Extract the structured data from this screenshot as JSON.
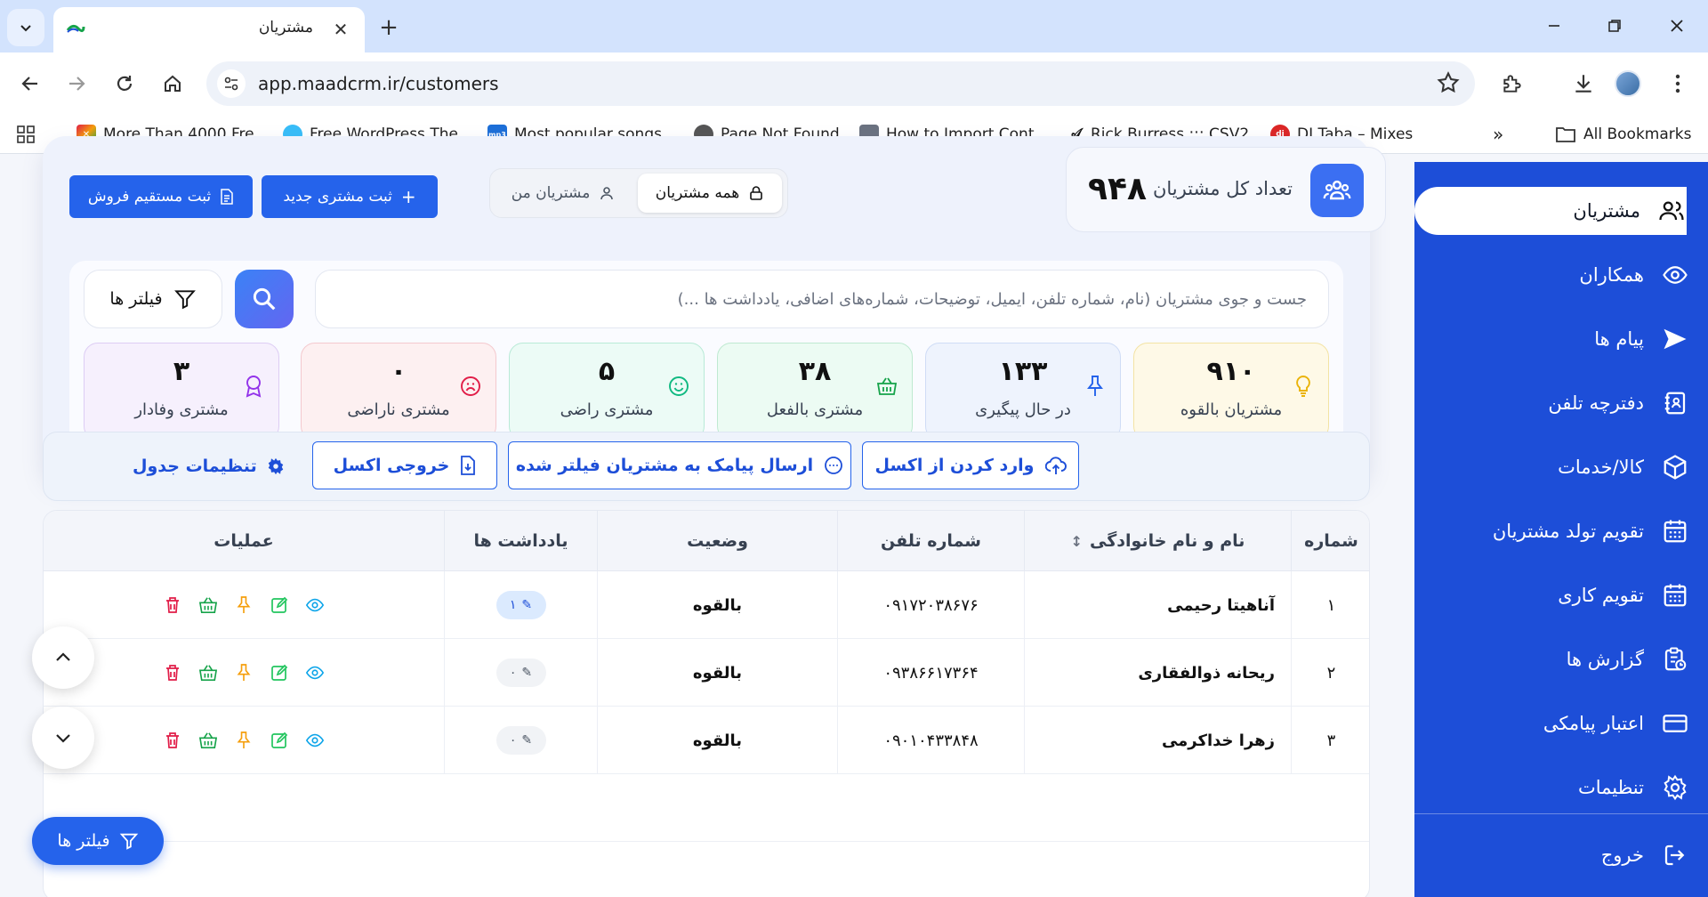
{
  "browser": {
    "tab_title": "مشتریان",
    "url": "app.maadcrm.ir/customers",
    "bookmarks": [
      {
        "label": "More Than 4000 Fre...",
        "icon": "colorful-x-icon"
      },
      {
        "label": "Free WordPress The...",
        "icon": "globe-blue-icon"
      },
      {
        "label": "Most popular songs...",
        "icon": "mp3-icon"
      },
      {
        "label": "Page Not Found",
        "icon": "globe-icon"
      },
      {
        "label": "How to Import Cont...",
        "icon": "lock-folder-icon"
      },
      {
        "label": "Rick Burress ::: CSV2...",
        "icon": "signature-icon"
      },
      {
        "label": "DJ Taba – Mixes",
        "icon": "dj-icon"
      }
    ],
    "all_bookmarks": "All Bookmarks"
  },
  "sidebar": {
    "items": [
      {
        "label": "مشتریان",
        "icon": "users-icon"
      },
      {
        "label": "همکاران",
        "icon": "eye-icon"
      },
      {
        "label": "پیام ها",
        "icon": "send-icon"
      },
      {
        "label": "دفترچه تلفن",
        "icon": "phonebook-icon"
      },
      {
        "label": "کالا/خدمات",
        "icon": "box-icon"
      },
      {
        "label": "تقویم تولد مشتریان",
        "icon": "calendar-icon"
      },
      {
        "label": "تقویم کاری",
        "icon": "calendar-icon"
      },
      {
        "label": "گزارش ها",
        "icon": "report-icon"
      },
      {
        "label": "اعتبار پیامکی",
        "icon": "credit-card-icon"
      },
      {
        "label": "تنظیمات",
        "icon": "gear-icon"
      }
    ],
    "logout": "خروج"
  },
  "header": {
    "count_label": "تعداد کل مشتریان",
    "count_value": "۹۴۸",
    "seg_all": "همه مشتریان",
    "seg_mine": "مشتریان من",
    "new_customer": "ثبت مشتری جدید",
    "direct_sale": "ثبت مستقیم فروش"
  },
  "search": {
    "placeholder": "جست و جوی مشتریان (نام، شماره تلفن، ایمیل، توضیحات، شماره‌های اضافی، یادداشت ها ...)",
    "filters": "فیلتر ها"
  },
  "stats": [
    {
      "value": "۹۱۰",
      "label": "مشتریان بالقوه",
      "bg": "#fef9e7",
      "border": "#f3e3a4",
      "icon_color": "#eab308"
    },
    {
      "value": "۱۳۳",
      "label": "در حال پیگیری",
      "bg": "#eef3fd",
      "border": "#cfdcf6",
      "icon_color": "#2563eb"
    },
    {
      "value": "۳۸",
      "label": "مشتری بالفعل",
      "bg": "#ecfbf3",
      "border": "#bfe9d1",
      "icon_color": "#16a34a"
    },
    {
      "value": "۵",
      "label": "مشتری راضی",
      "bg": "#ecfbf6",
      "border": "#b9ead7",
      "icon_color": "#10b981"
    },
    {
      "value": "۰",
      "label": "مشتری ناراضی",
      "bg": "#fdf0f1",
      "border": "#f4c9ce",
      "icon_color": "#e11d48"
    },
    {
      "value": "۳",
      "label": "مشتری وفادار",
      "bg": "#f6f0fd",
      "border": "#ddcdf4",
      "icon_color": "#9333ea"
    }
  ],
  "actions": {
    "import_excel": "وارد کردن از اکسل",
    "send_sms": "ارسال پیامک به مشتریان فیلتر شده",
    "export_excel": "خروجی اکسل",
    "table_settings": "تنظیمات جدول"
  },
  "table": {
    "headers": {
      "number": "شماره",
      "name": "نام و نام خانوادگی",
      "phone": "شماره تلفن",
      "status": "وضعیت",
      "notes": "یادداشت ها",
      "ops": "عملیات"
    },
    "rows": [
      {
        "num": "۱",
        "name": "آناهیتا رحیمی",
        "phone": "۰۹۱۷۲۰۳۸۶۷۶",
        "status": "بالقوه",
        "notes": "۱",
        "notes_active": true
      },
      {
        "num": "۲",
        "name": "ریحانه ذوالفقاری",
        "phone": "۰۹۳۸۶۶۱۷۳۶۴",
        "status": "بالقوه",
        "notes": "۰",
        "notes_active": false
      },
      {
        "num": "۳",
        "name": "زهرا خداکرمی",
        "phone": "۰۹۰۱۰۴۳۳۸۴۸",
        "status": "بالقوه",
        "notes": "۰",
        "notes_active": false
      }
    ]
  },
  "floating": {
    "filters": "فیلتر ها"
  }
}
